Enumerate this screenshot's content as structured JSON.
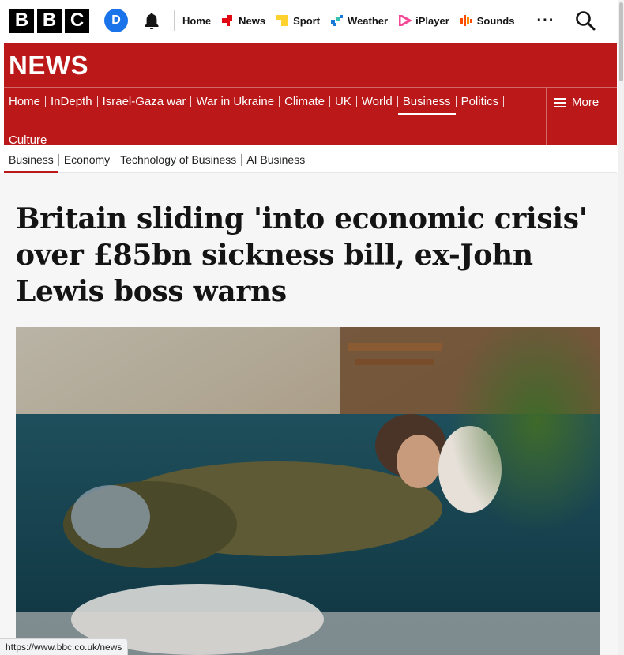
{
  "masthead": {
    "logo_letters": [
      "B",
      "B",
      "C"
    ],
    "account_initial": "D",
    "nav": [
      {
        "label": "Home",
        "icon": "none"
      },
      {
        "label": "News",
        "icon": "news-icon",
        "color": "#e30613"
      },
      {
        "label": "Sport",
        "icon": "sport-icon",
        "color": "#ffd230"
      },
      {
        "label": "Weather",
        "icon": "weather-icon",
        "color": "#1a7ad8"
      },
      {
        "label": "iPlayer",
        "icon": "iplayer-icon",
        "color": "#f54997"
      },
      {
        "label": "Sounds",
        "icon": "sounds-icon",
        "color": "#ff4c00"
      }
    ],
    "more_label": "···"
  },
  "news": {
    "title": "NEWS",
    "brand_color": "#bb1919",
    "sections": [
      "Home",
      "InDepth",
      "Israel-Gaza war",
      "War in Ukraine",
      "Climate",
      "UK",
      "World",
      "Business",
      "Politics",
      "Culture"
    ],
    "active_section": "Business",
    "more_label": "More"
  },
  "subnav": {
    "items": [
      "Business",
      "Economy",
      "Technology of Business",
      "AI Business"
    ],
    "active": "Business"
  },
  "article": {
    "headline": "Britain sliding 'into economic crisis' over £85bn sickness bill, ex-John Lewis boss warns"
  },
  "status_bar": {
    "url": "https://www.bbc.co.uk/news"
  }
}
